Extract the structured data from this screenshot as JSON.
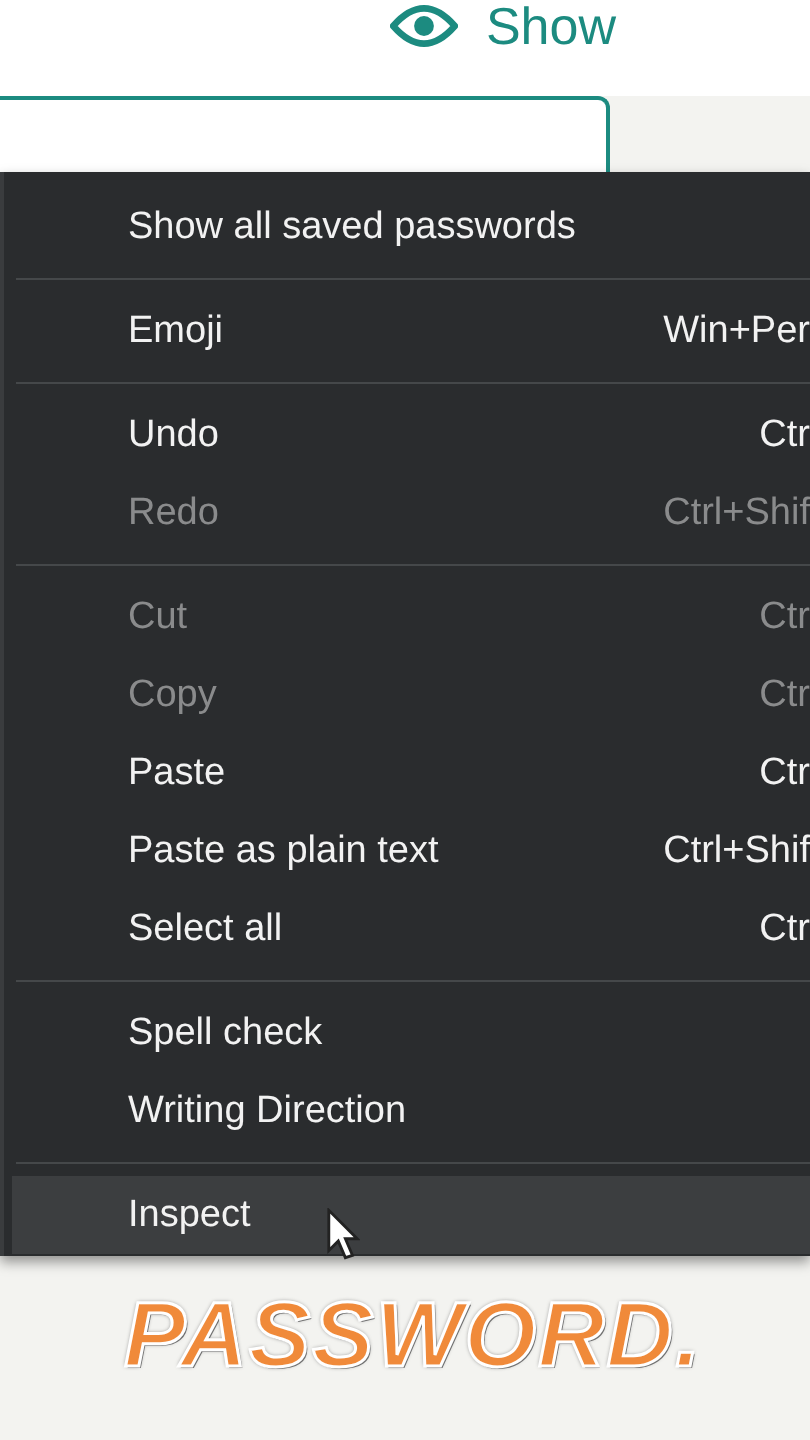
{
  "show_button": {
    "label": "Show"
  },
  "context_menu": {
    "groups": [
      {
        "items": [
          {
            "label": "Show all saved passwords",
            "disabled": false,
            "selected": false
          }
        ]
      },
      {
        "items": [
          {
            "label": "Emoji",
            "shortcut": "Win+Per",
            "disabled": false,
            "selected": false
          }
        ]
      },
      {
        "items": [
          {
            "label": "Undo",
            "shortcut": "Ctr",
            "disabled": false,
            "selected": false
          },
          {
            "label": "Redo",
            "shortcut": "Ctrl+Shif",
            "disabled": true,
            "selected": false
          }
        ]
      },
      {
        "items": [
          {
            "label": "Cut",
            "shortcut": "Ctr",
            "disabled": true,
            "selected": false
          },
          {
            "label": "Copy",
            "shortcut": "Ctr",
            "disabled": true,
            "selected": false
          },
          {
            "label": "Paste",
            "shortcut": "Ctr",
            "disabled": false,
            "selected": false
          },
          {
            "label": "Paste as plain text",
            "shortcut": "Ctrl+Shif",
            "disabled": false,
            "selected": false
          },
          {
            "label": "Select all",
            "shortcut": "Ctr",
            "disabled": false,
            "selected": false
          }
        ]
      },
      {
        "items": [
          {
            "label": "Spell check",
            "disabled": false,
            "selected": false
          },
          {
            "label": "Writing Direction",
            "disabled": false,
            "selected": false
          }
        ]
      },
      {
        "items": [
          {
            "label": "Inspect",
            "disabled": false,
            "selected": true
          }
        ]
      }
    ]
  },
  "caption": "PASSWORD."
}
